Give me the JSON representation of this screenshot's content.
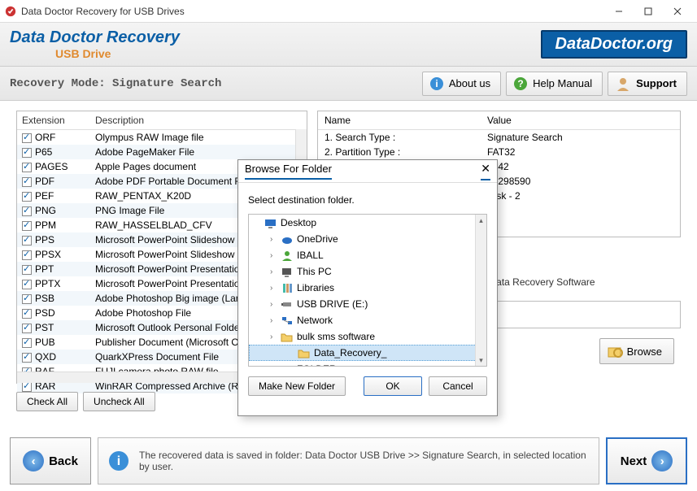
{
  "window": {
    "title": "Data Doctor Recovery for USB Drives"
  },
  "header": {
    "logo_line1": "Data Doctor Recovery",
    "logo_line2": "USB Drive",
    "site": "DataDoctor.org"
  },
  "topbar": {
    "mode_label": "Recovery Mode: Signature Search",
    "about": "About us",
    "help": "Help Manual",
    "support": "Support"
  },
  "ext_table": {
    "headers": [
      "Extension",
      "Description"
    ],
    "rows": [
      {
        "ext": "ORF",
        "desc": "Olympus RAW Image file"
      },
      {
        "ext": "P65",
        "desc": "Adobe PageMaker File"
      },
      {
        "ext": "PAGES",
        "desc": "Apple Pages document"
      },
      {
        "ext": "PDF",
        "desc": "Adobe PDF Portable Document F"
      },
      {
        "ext": "PEF",
        "desc": "RAW_PENTAX_K20D"
      },
      {
        "ext": "PNG",
        "desc": "PNG Image File"
      },
      {
        "ext": "PPM",
        "desc": "RAW_HASSELBLAD_CFV"
      },
      {
        "ext": "PPS",
        "desc": "Microsoft PowerPoint Slideshow ("
      },
      {
        "ext": "PPSX",
        "desc": "Microsoft PowerPoint Slideshow ("
      },
      {
        "ext": "PPT",
        "desc": "Microsoft PowerPoint Presentatio"
      },
      {
        "ext": "PPTX",
        "desc": "Microsoft PowerPoint Presentatio"
      },
      {
        "ext": "PSB",
        "desc": "Adobe Photoshop Big image (Lar"
      },
      {
        "ext": "PSD",
        "desc": "Adobe Photoshop File"
      },
      {
        "ext": "PST",
        "desc": "Microsoft Outlook Personal Folde"
      },
      {
        "ext": "PUB",
        "desc": "Publisher Document (Microsoft O"
      },
      {
        "ext": "QXD",
        "desc": "QuarkXPress Document File"
      },
      {
        "ext": "RAF",
        "desc": "FUJI camera photo RAW file"
      },
      {
        "ext": "RAR",
        "desc": "WinRAR Compressed Archive (Ra"
      }
    ]
  },
  "check_buttons": {
    "all": "Check All",
    "none": "Uncheck All"
  },
  "info_panel": {
    "headers": [
      "Name",
      "Value"
    ],
    "rows": [
      {
        "name": "1. Search Type :",
        "value": "Signature Search"
      },
      {
        "name": "2. Partition Type :",
        "value": "FAT32"
      },
      {
        "name": "",
        "value": "2042"
      },
      {
        "name": "",
        "value": "30298590"
      },
      {
        "name": "",
        "value": "Disk - 2"
      }
    ]
  },
  "save_msg_tail": "ll be saved by DDR Data Recovery Software",
  "browse": "Browse",
  "dialog": {
    "title": "Browse For Folder",
    "msg": "Select destination folder.",
    "tree": [
      {
        "label": "Desktop",
        "indent": 0,
        "icon": "desktop",
        "exp": ""
      },
      {
        "label": "OneDrive",
        "indent": 1,
        "icon": "cloud",
        "exp": "›"
      },
      {
        "label": "IBALL",
        "indent": 1,
        "icon": "user",
        "exp": "›"
      },
      {
        "label": "This PC",
        "indent": 1,
        "icon": "pc",
        "exp": "›"
      },
      {
        "label": "Libraries",
        "indent": 1,
        "icon": "lib",
        "exp": "›"
      },
      {
        "label": "USB DRIVE (E:)",
        "indent": 1,
        "icon": "usb",
        "exp": "›"
      },
      {
        "label": "Network",
        "indent": 1,
        "icon": "net",
        "exp": "›"
      },
      {
        "label": "bulk sms software",
        "indent": 1,
        "icon": "folder",
        "exp": "›"
      },
      {
        "label": "Data_Recovery_",
        "indent": 2,
        "icon": "folder",
        "exp": "",
        "sel": true
      },
      {
        "label": "FOLDER",
        "indent": 1,
        "icon": "folder",
        "exp": "›"
      }
    ],
    "make_folder": "Make New Folder",
    "ok": "OK",
    "cancel": "Cancel"
  },
  "bottom": {
    "back": "Back",
    "next": "Next",
    "info": "The recovered data is saved in folder: Data Doctor USB Drive  >> Signature Search, in selected location by user."
  }
}
